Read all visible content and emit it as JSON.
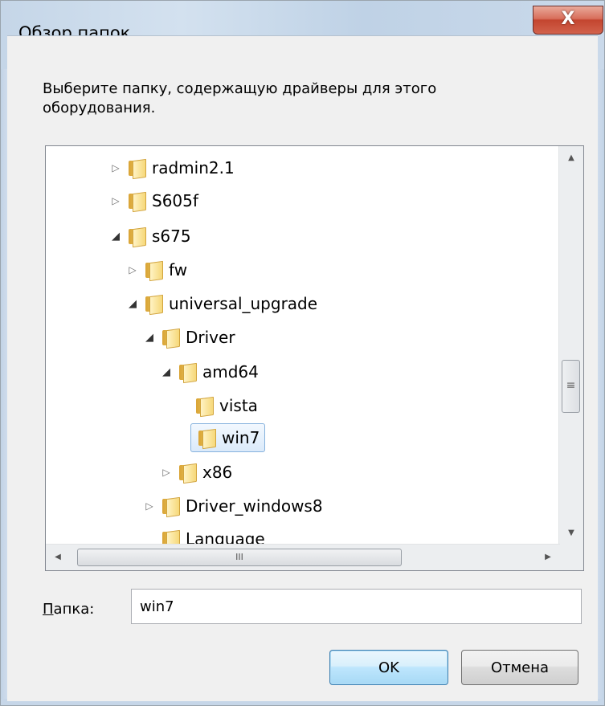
{
  "window": {
    "title": "Обзор папок",
    "close_glyph": "X"
  },
  "instructions": "Выберите папку, содержащую драйверы для этого оборудования.",
  "tree": {
    "items": [
      {
        "label": "radmin2.1",
        "expander": "▷"
      },
      {
        "label": "S605f",
        "expander": "▷"
      },
      {
        "label": "s675",
        "expander": "◢"
      },
      {
        "label": "fw",
        "expander": "▷"
      },
      {
        "label": "universal_upgrade",
        "expander": "◢"
      },
      {
        "label": "Driver",
        "expander": "◢"
      },
      {
        "label": "amd64",
        "expander": "◢"
      },
      {
        "label": "vista",
        "expander": ""
      },
      {
        "label": "win7",
        "expander": "",
        "selected": true
      },
      {
        "label": "x86",
        "expander": "▷"
      },
      {
        "label": "Driver_windows8",
        "expander": "▷"
      },
      {
        "label": "Language",
        "expander": ""
      }
    ]
  },
  "scroll": {
    "up": "▲",
    "down": "▼",
    "left": "◀",
    "right": "▶",
    "grip_v": "≡",
    "grip_h": "III"
  },
  "folder_field": {
    "label_underlined": "П",
    "label_rest": "апка:",
    "value": "win7"
  },
  "buttons": {
    "ok": "OK",
    "cancel": "Отмена"
  }
}
